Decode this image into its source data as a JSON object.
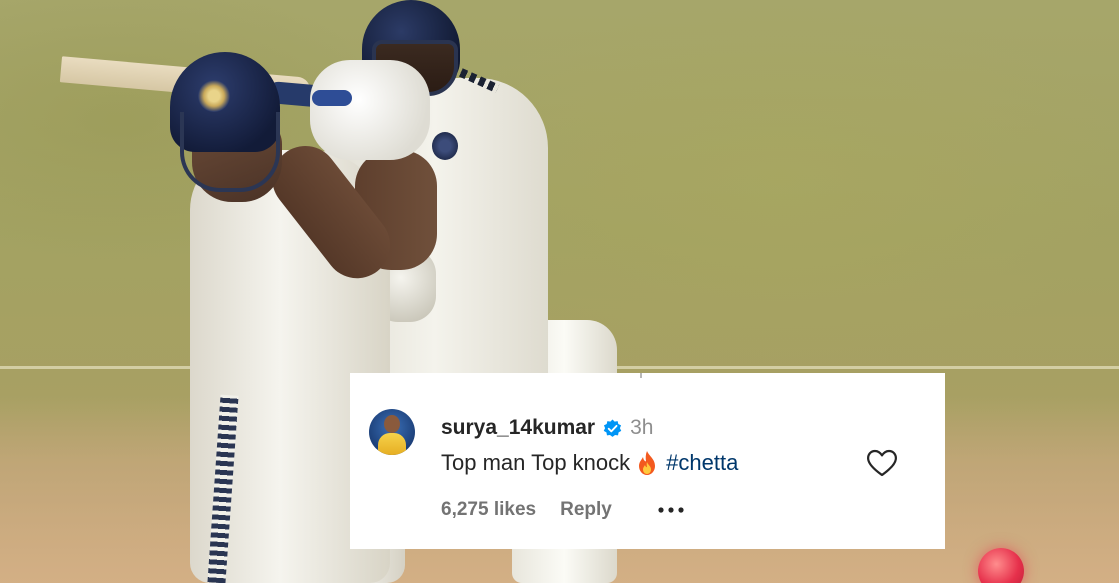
{
  "comment": {
    "username": "surya_14kumar",
    "time": "3h",
    "text": "Top man Top knock",
    "hashtag": "#chetta",
    "likes": "6,275 likes",
    "reply_label": "Reply"
  },
  "icons": {
    "verified": "verified-badge-icon",
    "emoji": "fire-icon",
    "like": "heart-icon",
    "more": "more-options-icon"
  },
  "colors": {
    "verified_blue": "#0095f6",
    "hashtag_blue": "#00376b",
    "ball_red": "#e6304b",
    "card_bg": "#ffffff",
    "text_primary": "#262626",
    "text_secondary": "#737373"
  }
}
